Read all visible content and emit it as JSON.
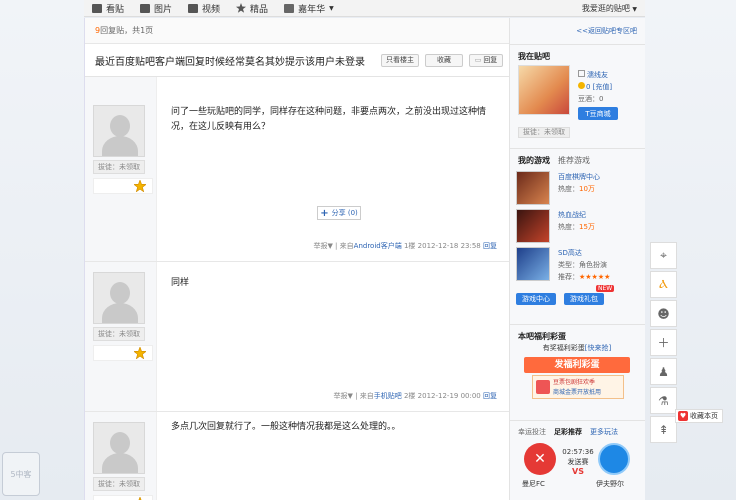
{
  "nav": {
    "items": [
      {
        "label": "看贴",
        "icon": "list-icon"
      },
      {
        "label": "图片",
        "icon": "image-icon"
      },
      {
        "label": "视频",
        "icon": "video-icon"
      },
      {
        "label": "精品",
        "icon": "star-icon"
      },
      {
        "label": "嘉年华",
        "icon": "carnival-icon"
      }
    ],
    "right_label": "我爱逛的贴吧"
  },
  "pagebar": {
    "count": "9",
    "text": "回复贴，共1页"
  },
  "thread": {
    "title": "最近百度贴吧客户端回复时候经常莫名其妙提示该用户未登录",
    "buttons": {
      "only_owner": "只看楼主",
      "favorite": "收藏",
      "reply": "回复"
    }
  },
  "posts": [
    {
      "user": "拔徒：未领取",
      "text": "问了一些玩贴吧的同学，同样存在这种问题，非要点两次，之前没出现过这种情况，在这儿反映有用么？",
      "share": "分享 (0)",
      "foot_report": "举报",
      "foot_from": "来自",
      "foot_client": "Android客户端",
      "foot_floor": "1楼",
      "foot_time": "2012-12-18 23:58",
      "foot_reply": "回复"
    },
    {
      "user": "拔徒：未领取",
      "text": "同样",
      "foot_report": "举报",
      "foot_from": "来自",
      "foot_client": "手机贴吧",
      "foot_floor": "2楼",
      "foot_time": "2012-12-19 00:00",
      "foot_reply": "回复"
    },
    {
      "user": "拔徒：未领取",
      "text": "多点几次回复就行了。一般这种情况我都是这么处理的。。"
    }
  ],
  "sidebar": {
    "backlink": "<<返回贴吧专区吧",
    "me": {
      "title": "我在贴吧",
      "username": "濡线友",
      "recharge": "0 [充值]",
      "beans": "豆酒：0",
      "mall_button": "T豆商城",
      "badge": "拔徒：未领取"
    },
    "games": {
      "tab_mine": "我的游戏",
      "tab_rec": "推荐游戏",
      "list": [
        {
          "name": "百度棋牌中心",
          "heat_label": "热度：",
          "heat": "10万"
        },
        {
          "name": "热血战纪",
          "heat_label": "热度：",
          "heat": "15万"
        },
        {
          "name": "SD高达",
          "type_label": "类型：角色扮演",
          "rec_label": "推荐：",
          "stars": "★★★★★"
        }
      ],
      "btn_center": "游戏中心",
      "btn_gift": "游戏礼包",
      "new_badge": "NEW"
    },
    "lottery": {
      "title": "本吧福利彩蛋",
      "subtitle": "有奖福利彩蛋",
      "link": "[快来抢]",
      "button": "发福利彩蛋",
      "promo1": "豆票包剧狂欢季",
      "promo2": "商城金票开放抵用"
    },
    "sports": {
      "tab1": "幸运投注",
      "tab2": "足彩推荐",
      "tab3": "更多玩法",
      "time": "02:57:36",
      "status": "发送赛",
      "vs": "VS",
      "team_left": "曼尼FC",
      "team_right": "伊夫野尔"
    }
  },
  "float": {
    "favorite": "收藏本页"
  },
  "watermark": "5中客"
}
